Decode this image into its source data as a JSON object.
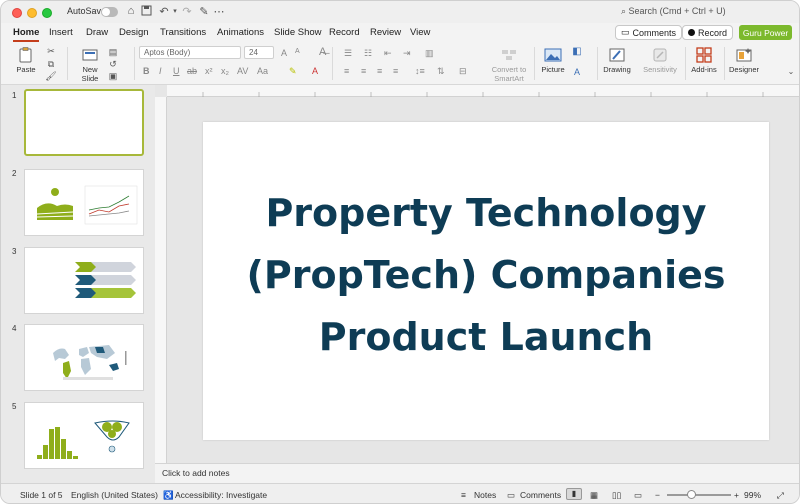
{
  "titlebar": {
    "autosave_label": "AutoSave",
    "search_placeholder": "Search (Cmd + Ctrl + U)"
  },
  "tabs": [
    "Home",
    "Insert",
    "Draw",
    "Design",
    "Transitions",
    "Animations",
    "Slide Show",
    "Record",
    "Review",
    "View"
  ],
  "active_tab": "Home",
  "top_buttons": {
    "comments": "Comments",
    "record": "Record",
    "guru": "Guru Power"
  },
  "ribbon": {
    "paste": "Paste",
    "new_slide_line1": "New",
    "new_slide_line2": "Slide",
    "font_name": "Aptos (Body)",
    "font_size": "24",
    "convert_line1": "Convert to",
    "convert_line2": "SmartArt",
    "picture": "Picture",
    "drawing": "Drawing",
    "sensitivity": "Sensitivity",
    "addins": "Add-ins",
    "designer": "Designer"
  },
  "slides": [
    {
      "number": "1"
    },
    {
      "number": "2"
    },
    {
      "number": "3"
    },
    {
      "number": "4"
    },
    {
      "number": "5"
    }
  ],
  "current_slide": {
    "title_line1": "Property Technology",
    "title_line2": "(PropTech) Companies",
    "title_line3": "Product Launch",
    "title_color": "#0e3c55"
  },
  "notes_placeholder": "Click to add notes",
  "status": {
    "slide_info": "Slide 1 of 5",
    "language": "English (United States)",
    "accessibility": "Accessibility: Investigate",
    "notes": "Notes",
    "comments": "Comments",
    "zoom": "99%"
  },
  "colors": {
    "accent_green": "#7cb92d",
    "active_tab_underline": "#c43e1c",
    "selected_thumb_border": "#a7b83a"
  }
}
